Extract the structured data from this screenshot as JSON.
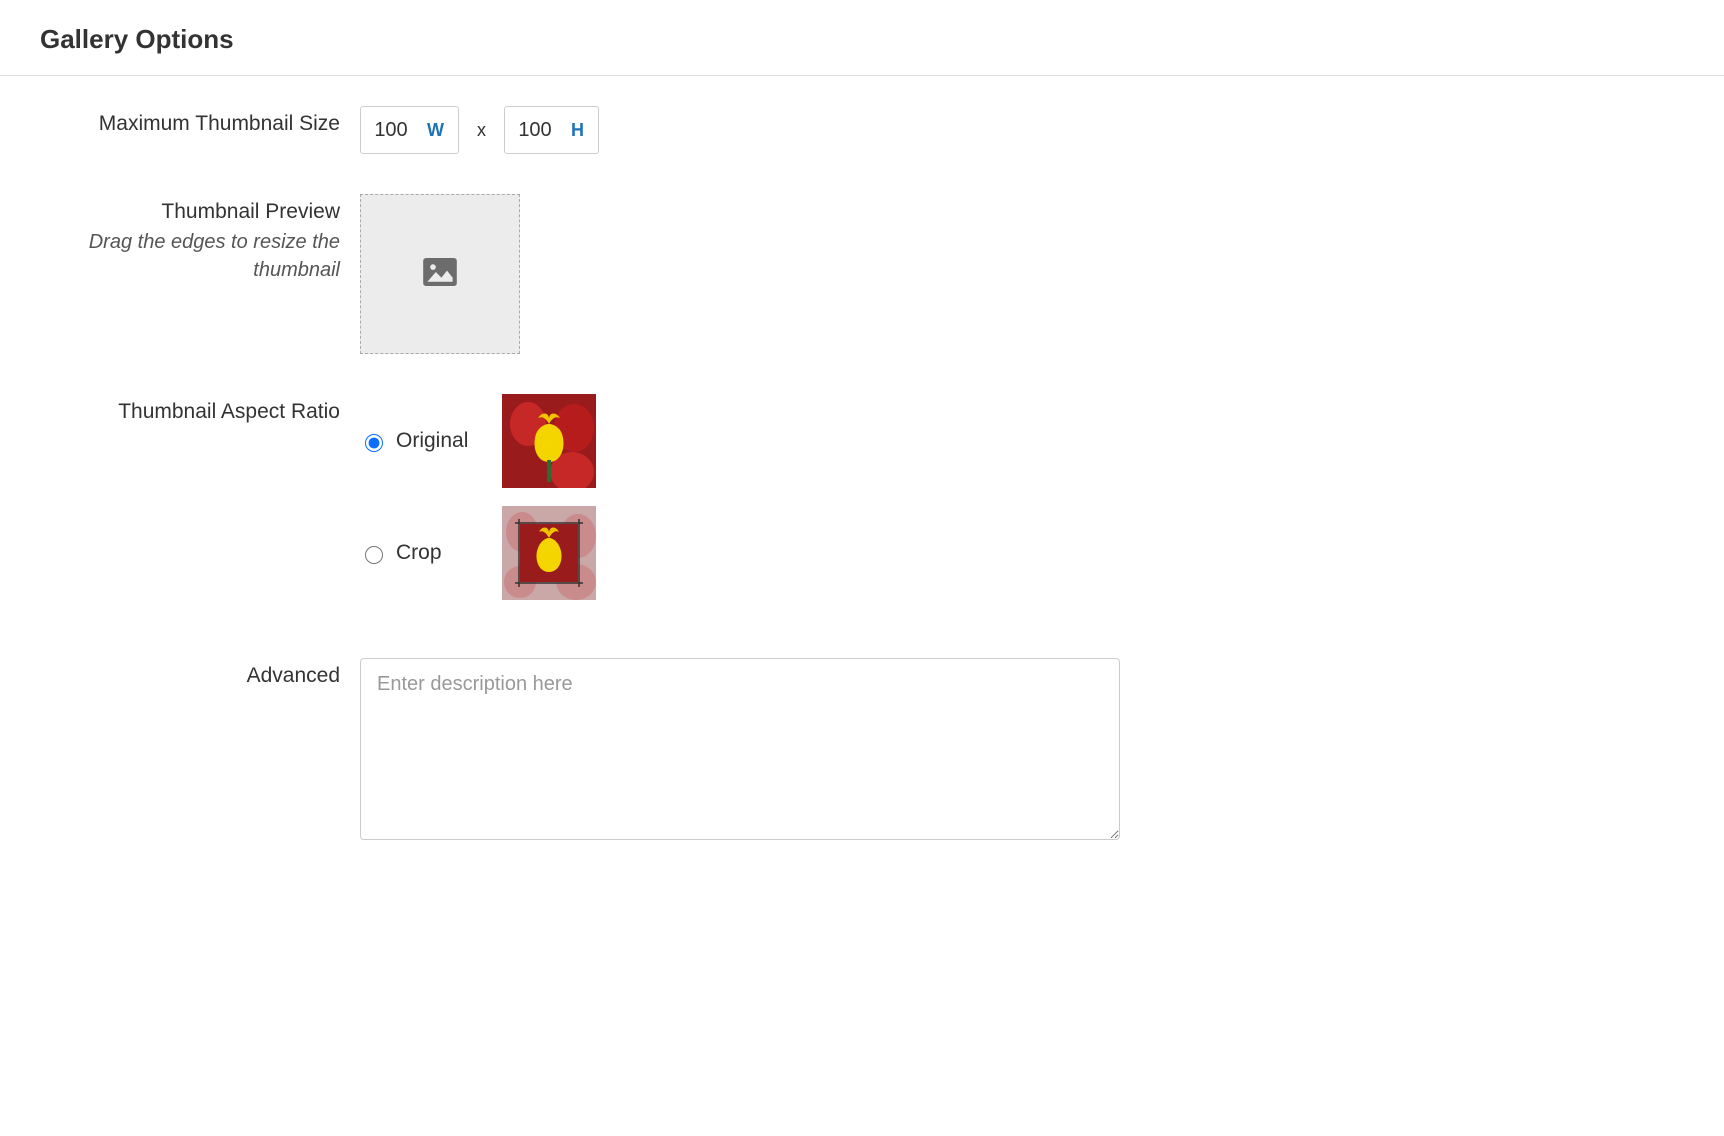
{
  "section": {
    "title": "Gallery Options"
  },
  "thumbSize": {
    "label": "Maximum Thumbnail Size",
    "width": "100",
    "height": "100",
    "wLetter": "W",
    "hLetter": "H",
    "separator": "x"
  },
  "preview": {
    "label": "Thumbnail Preview",
    "hint": "Drag the edges to resize the thumbnail"
  },
  "aspect": {
    "label": "Thumbnail Aspect Ratio",
    "options": [
      {
        "value": "original",
        "label": "Original",
        "selected": true
      },
      {
        "value": "crop",
        "label": "Crop",
        "selected": false
      }
    ]
  },
  "advanced": {
    "label": "Advanced",
    "value": "",
    "placeholder": "Enter description here"
  }
}
